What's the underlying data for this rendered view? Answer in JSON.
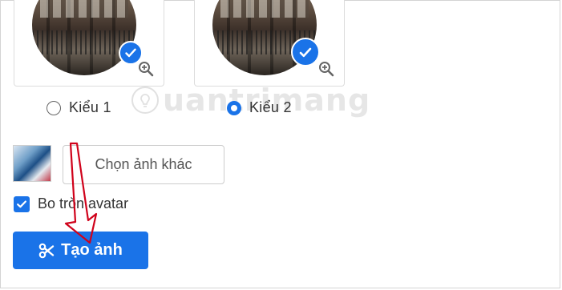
{
  "styles": {
    "accent": "#1a73e8",
    "annotation_arrow": "#d0021b"
  },
  "style_options": [
    {
      "label": "Kiểu 1",
      "selected": false
    },
    {
      "label": "Kiểu 2",
      "selected": true
    }
  ],
  "watermark": {
    "text": "uantrimang"
  },
  "file_picker": {
    "label": "Chọn ảnh khác"
  },
  "round_avatar": {
    "label": "Bo tròn avatar",
    "checked": true
  },
  "create_button": {
    "label": "Tạo ảnh",
    "icon": "scissors-icon"
  },
  "icons": {
    "check": "check-icon",
    "zoom": "zoom-in-icon",
    "checkbox": "checkbox-checked-icon"
  }
}
